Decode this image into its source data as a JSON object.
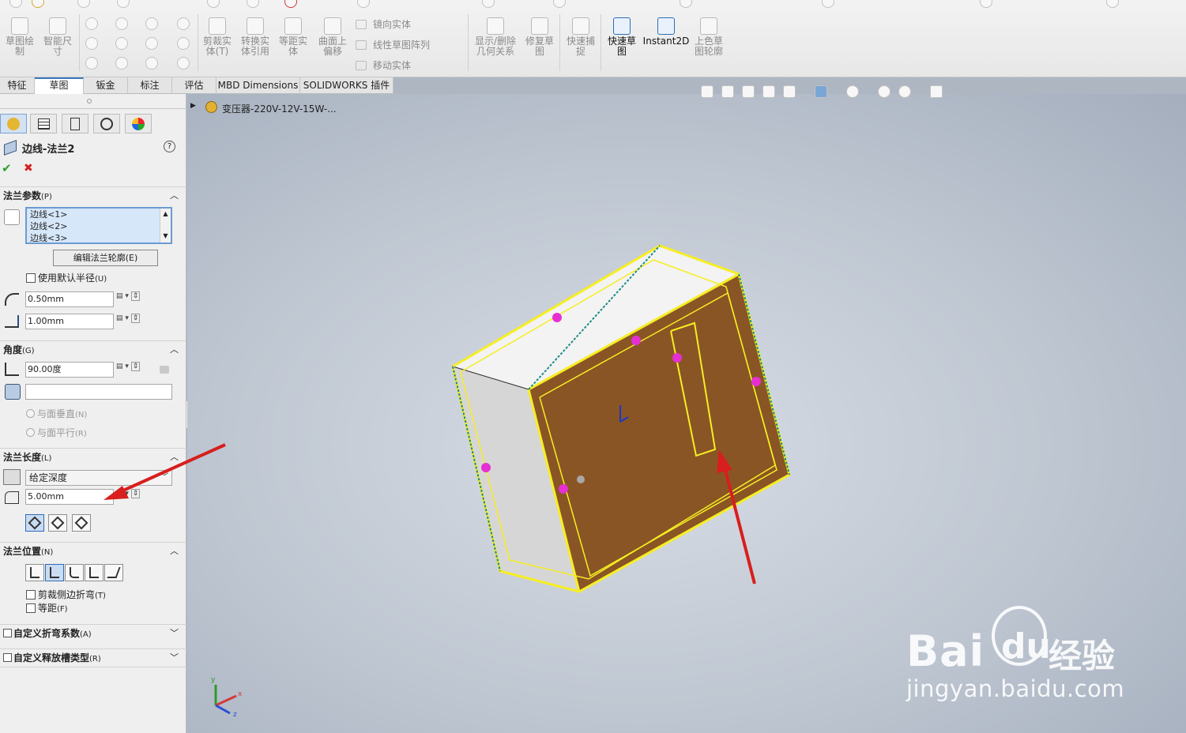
{
  "toolbar": {
    "buttons": [
      {
        "label": "草图绘\n制"
      },
      {
        "label": "智能尺\n寸"
      },
      {
        "label": "剪裁实\n体(T)"
      },
      {
        "label": "转换实\n体引用"
      },
      {
        "label": "等距实\n体"
      },
      {
        "label": "曲面上\n偏移"
      },
      {
        "label": "显示/删除\n几何关系"
      },
      {
        "label": "修复草\n图"
      },
      {
        "label": "快速捕\n捉"
      },
      {
        "label": "快速草\n图"
      },
      {
        "label": "Instant2D"
      },
      {
        "label": "上色草\n图轮廓"
      }
    ],
    "rows": [
      {
        "label": "镜向实体"
      },
      {
        "label": "线性草图阵列"
      },
      {
        "label": "移动实体"
      }
    ]
  },
  "tabs": [
    "特征",
    "草图",
    "钣金",
    "标注",
    "评估",
    "MBD Dimensions",
    "SOLIDWORKS 插件"
  ],
  "active_tab": "草图",
  "tree": {
    "root_label": "变压器-220V-12V-15W-..."
  },
  "panel": {
    "title": "边线-法兰2",
    "help_icon": "?",
    "ok_icon": "✔",
    "cancel_icon": "✖",
    "flange_params": {
      "header": "法兰参数",
      "header_key": "(P)",
      "edges": [
        "边线<1>",
        "边线<2>",
        "边线<3>"
      ],
      "edit_button": "编辑法兰轮廓(E)",
      "use_default_radius": "使用默认半径",
      "use_default_radius_key": "(U)",
      "radius_value": "0.50mm",
      "gap_value": "1.00mm"
    },
    "angle": {
      "header": "角度",
      "header_key": "(G)",
      "angle_value": "90.00度",
      "select_face_value": "",
      "normal_option": "与面垂直",
      "normal_key": "(N)",
      "parallel_option": "与面平行",
      "parallel_key": "(R)"
    },
    "flange_length": {
      "header": "法兰长度",
      "header_key": "(L)",
      "end_condition": "给定深度",
      "length_value": "5.00mm"
    },
    "flange_position": {
      "header": "法兰位置",
      "header_key": "(N)",
      "trim_side_bends": "剪裁侧边折弯",
      "trim_side_bends_key": "(T)",
      "offset": "等距",
      "offset_key": "(F)"
    },
    "custom_bend": {
      "label": "自定义折弯系数",
      "key": "(A)"
    },
    "custom_relief": {
      "label": "自定义释放槽类型",
      "key": "(R)"
    }
  },
  "triad": {
    "x": "x",
    "y": "y",
    "z": "z"
  },
  "watermark": {
    "brand": "Bai",
    "brand2": "du",
    "jingyan": "经验",
    "url": "jingyan.baidu.com"
  },
  "colors": {
    "accent": "#3a78c2",
    "model_face": "#8a5524",
    "selection": "#f6ee23",
    "arrow_marker": "#e62fd2",
    "annotation_arrow": "#d81e1e",
    "watermark": "#ffffff"
  }
}
